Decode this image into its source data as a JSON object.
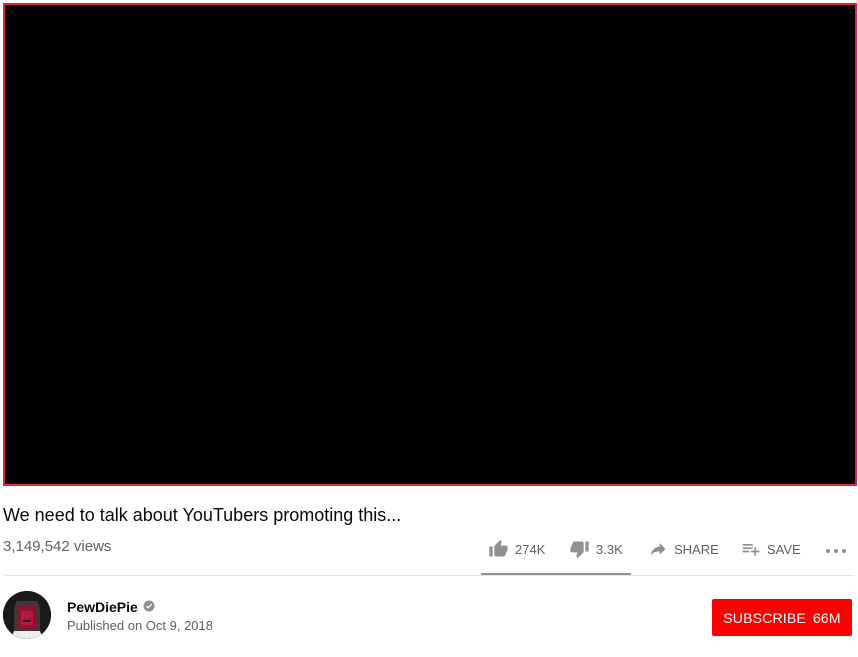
{
  "video": {
    "title": "We need to talk about YouTubers promoting this...",
    "views": "3,149,542 views"
  },
  "actions": {
    "likes": "274K",
    "dislikes": "3.3K",
    "share_label": "SHARE",
    "save_label": "SAVE"
  },
  "channel": {
    "name": "PewDiePie",
    "published": "Published on Oct 9, 2018",
    "verified": true
  },
  "subscribe": {
    "label": "SUBSCRIBE",
    "count": "66M"
  },
  "colors": {
    "accent": "#ff0000",
    "player_border": "#e0282e",
    "secondary_text": "#606060"
  },
  "icons": [
    "thumbs-up-icon",
    "thumbs-down-icon",
    "share-icon",
    "playlist-add-icon",
    "more-icon",
    "verified-icon"
  ],
  "sentiment": {
    "like_fraction": 0.988
  }
}
